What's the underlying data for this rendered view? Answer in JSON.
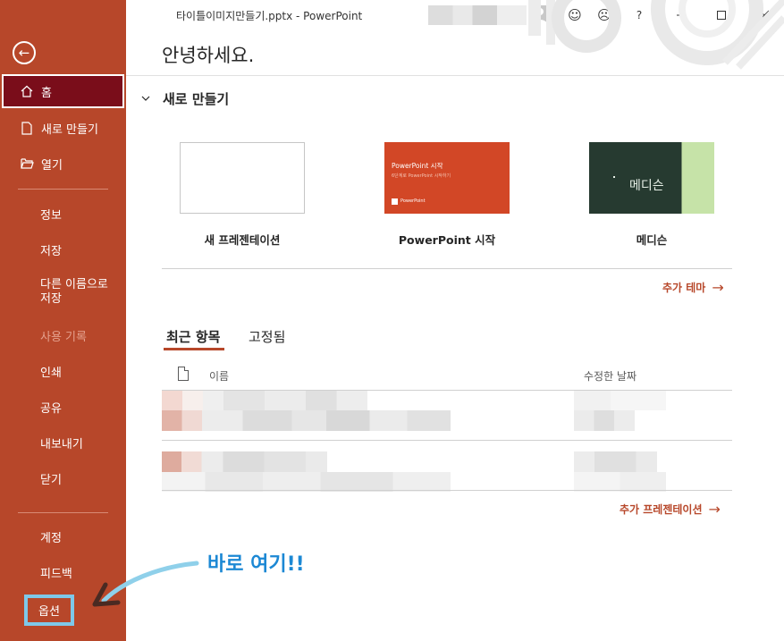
{
  "window": {
    "title": "타이틀이미지만들기.pptx  -  PowerPoint",
    "help_glyph": "?"
  },
  "header": {
    "greeting": "안녕하세요."
  },
  "sidebar": {
    "home": "홈",
    "new": "새로 만들기",
    "open": "열기",
    "info": "정보",
    "save": "저장",
    "save_as_line1": "다른 이름으로",
    "save_as_line2": "저장",
    "history": "사용 기록",
    "print": "인쇄",
    "share": "공유",
    "export": "내보내기",
    "close": "닫기",
    "account": "계정",
    "feedback": "피드백",
    "options": "옵션"
  },
  "new_section": {
    "title": "새로 만들기",
    "templates": [
      {
        "label": "새 프레젠테이션"
      },
      {
        "label": "PowerPoint 시작",
        "thumb_title": "PowerPoint 시작",
        "thumb_sub": "6단계로 PowerPoint 시작하기",
        "thumb_logo": "PowerPoint"
      },
      {
        "label": "메디슨",
        "thumb_title": "메디슨"
      }
    ],
    "more_themes": "추가 테마"
  },
  "recent": {
    "tabs": [
      "최근 항목",
      "고정됨"
    ],
    "col_name": "이름",
    "col_modified": "수정한 날짜",
    "more_presentations": "추가 프레젠테이션"
  },
  "annotation": {
    "text": "바로 여기!!"
  },
  "colors": {
    "sidebar": "#b7472a",
    "sidebar_active": "#7a0d1a",
    "accent": "#b7472a",
    "annotation": "#1c88d4",
    "highlight_box": "#7ec8e9"
  }
}
